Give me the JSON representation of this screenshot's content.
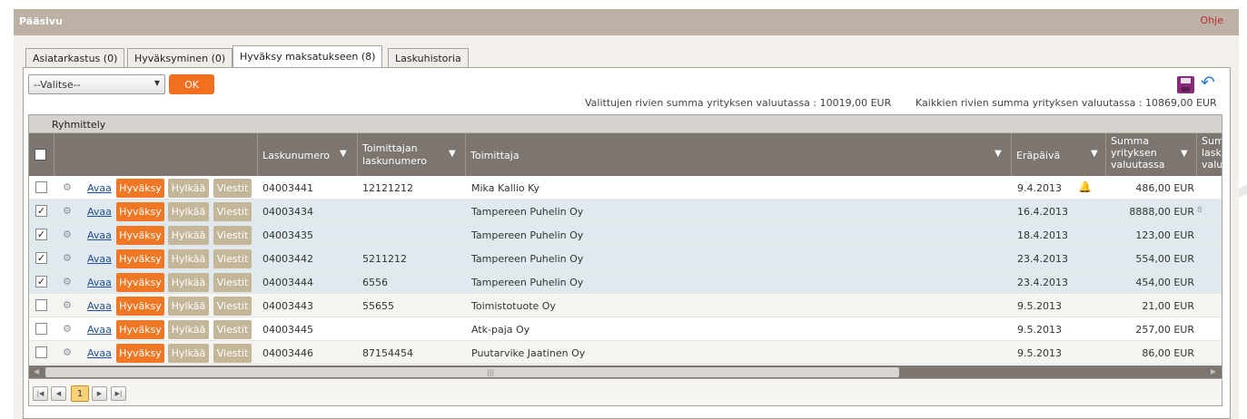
{
  "page": {
    "title": "Pääsivu",
    "help_link": "Ohje"
  },
  "tabs": [
    {
      "label": "Asiatarkastus (0)",
      "active": false
    },
    {
      "label": "Hyväksyminen (0)",
      "active": false
    },
    {
      "label": "Hyväksy maksatukseen (8)",
      "active": true
    },
    {
      "label": "Laskuhistoria",
      "active": false
    }
  ],
  "toolbar": {
    "select_value": "--Valitse--",
    "ok_label": "OK",
    "save_icon": "save-icon",
    "undo_icon": "undo-icon",
    "selected_sum": "Valittujen rivien summa yrityksen valuutassa : 10019,00 EUR",
    "all_sum": "Kaikkien rivien summa yrityksen valuutassa : 10869,00 EUR"
  },
  "grid": {
    "group_label": "Ryhmittely",
    "columns": {
      "invoice_number": "Laskunumero",
      "supplier_invoice_line1": "Toimittajan",
      "supplier_invoice_line2": "laskunumero",
      "supplier": "Toimittaja",
      "due_date": "Eräpäivä",
      "sum_line1": "Summa",
      "sum_line2": "yrityksen",
      "sum_line3": "valuutassa",
      "cut_line1": "Sum",
      "cut_line2": "lask",
      "cut_line3": "valu"
    },
    "action_labels": {
      "open": "Avaa",
      "approve": "Hyväksy",
      "reject": "Hylkää",
      "messages": "Viestit"
    },
    "rows": [
      {
        "checked": false,
        "invoice": "04003441",
        "supplier_invoice": "12121212",
        "supplier": "Mika Kallio Ky",
        "due": "9.4.2013",
        "amount": "486,00 EUR",
        "bell": true,
        "cut": ""
      },
      {
        "checked": true,
        "invoice": "04003434",
        "supplier_invoice": "",
        "supplier": "Tampereen Puhelin Oy",
        "due": "16.4.2013",
        "amount": "8888,00 EUR",
        "bell": false,
        "cut": "8"
      },
      {
        "checked": true,
        "invoice": "04003435",
        "supplier_invoice": "",
        "supplier": "Tampereen Puhelin Oy",
        "due": "18.4.2013",
        "amount": "123,00 EUR",
        "bell": false,
        "cut": ""
      },
      {
        "checked": true,
        "invoice": "04003442",
        "supplier_invoice": "5211212",
        "supplier": "Tampereen Puhelin Oy",
        "due": "23.4.2013",
        "amount": "554,00 EUR",
        "bell": false,
        "cut": ""
      },
      {
        "checked": true,
        "invoice": "04003444",
        "supplier_invoice": "6556",
        "supplier": "Tampereen Puhelin Oy",
        "due": "23.4.2013",
        "amount": "454,00 EUR",
        "bell": false,
        "cut": ""
      },
      {
        "checked": false,
        "invoice": "04003443",
        "supplier_invoice": "55655",
        "supplier": "Toimistotuote Oy",
        "due": "9.5.2013",
        "amount": "21,00 EUR",
        "bell": false,
        "cut": ""
      },
      {
        "checked": false,
        "invoice": "04003445",
        "supplier_invoice": "",
        "supplier": "Atk-paja Oy",
        "due": "9.5.2013",
        "amount": "257,00 EUR",
        "bell": false,
        "cut": ""
      },
      {
        "checked": false,
        "invoice": "04003446",
        "supplier_invoice": "87154454",
        "supplier": "Puutarvike Jaatinen Oy",
        "due": "9.5.2013",
        "amount": "86,00 EUR",
        "bell": false,
        "cut": ""
      }
    ]
  },
  "pager": {
    "current_page": "1"
  },
  "colors": {
    "accent": "#f26f1f",
    "header": "#7c7570",
    "titlebar": "#bdb1a6",
    "muted_button": "#c4b699"
  }
}
